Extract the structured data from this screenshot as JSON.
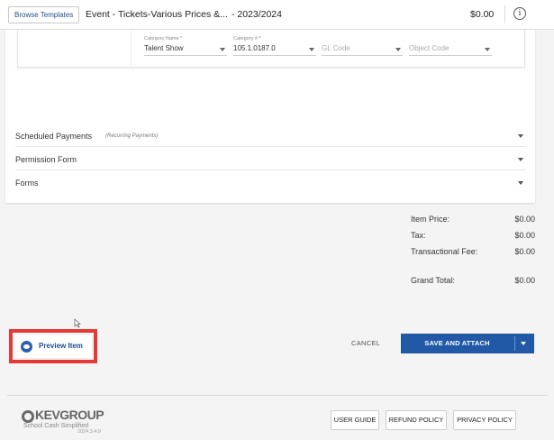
{
  "header": {
    "templates_button": "Browse Templates",
    "title": "Event - Tickets-Various Prices &...",
    "year": "- 2023/2024",
    "total": "$0.00",
    "info_icon": "i"
  },
  "account_fields": {
    "category_name": {
      "label": "Category Name *",
      "value": "Talent Show"
    },
    "category_num": {
      "label": "Category # *",
      "value": "105.1.0187.0"
    },
    "gl_code": {
      "placeholder": "GL Code"
    },
    "object_code": {
      "placeholder": "Object Code"
    }
  },
  "sections": [
    {
      "title": "Scheduled Payments",
      "subtitle": "(Recurring Payments)"
    },
    {
      "title": "Permission Form",
      "subtitle": ""
    },
    {
      "title": "Forms",
      "subtitle": ""
    }
  ],
  "totals": {
    "item_price": {
      "label": "Item Price:",
      "value": "$0.00"
    },
    "tax": {
      "label": "Tax:",
      "value": "$0.00"
    },
    "fee": {
      "label": "Transactional Fee:",
      "value": "$0.00"
    },
    "grand": {
      "label": "Grand Total:",
      "value": "$0.00"
    }
  },
  "actions": {
    "preview": "Preview Item",
    "cancel": "CANCEL",
    "save": "SAVE AND ATTACH"
  },
  "footer": {
    "brand": "KEVGROUP",
    "tagline": "School Cash Simplified",
    "version": "2024.3.4.9",
    "links": [
      "USER GUIDE",
      "REFUND POLICY",
      "PRIVACY POLICY"
    ]
  },
  "colors": {
    "primary": "#2159a6",
    "highlight": "#e53935"
  }
}
